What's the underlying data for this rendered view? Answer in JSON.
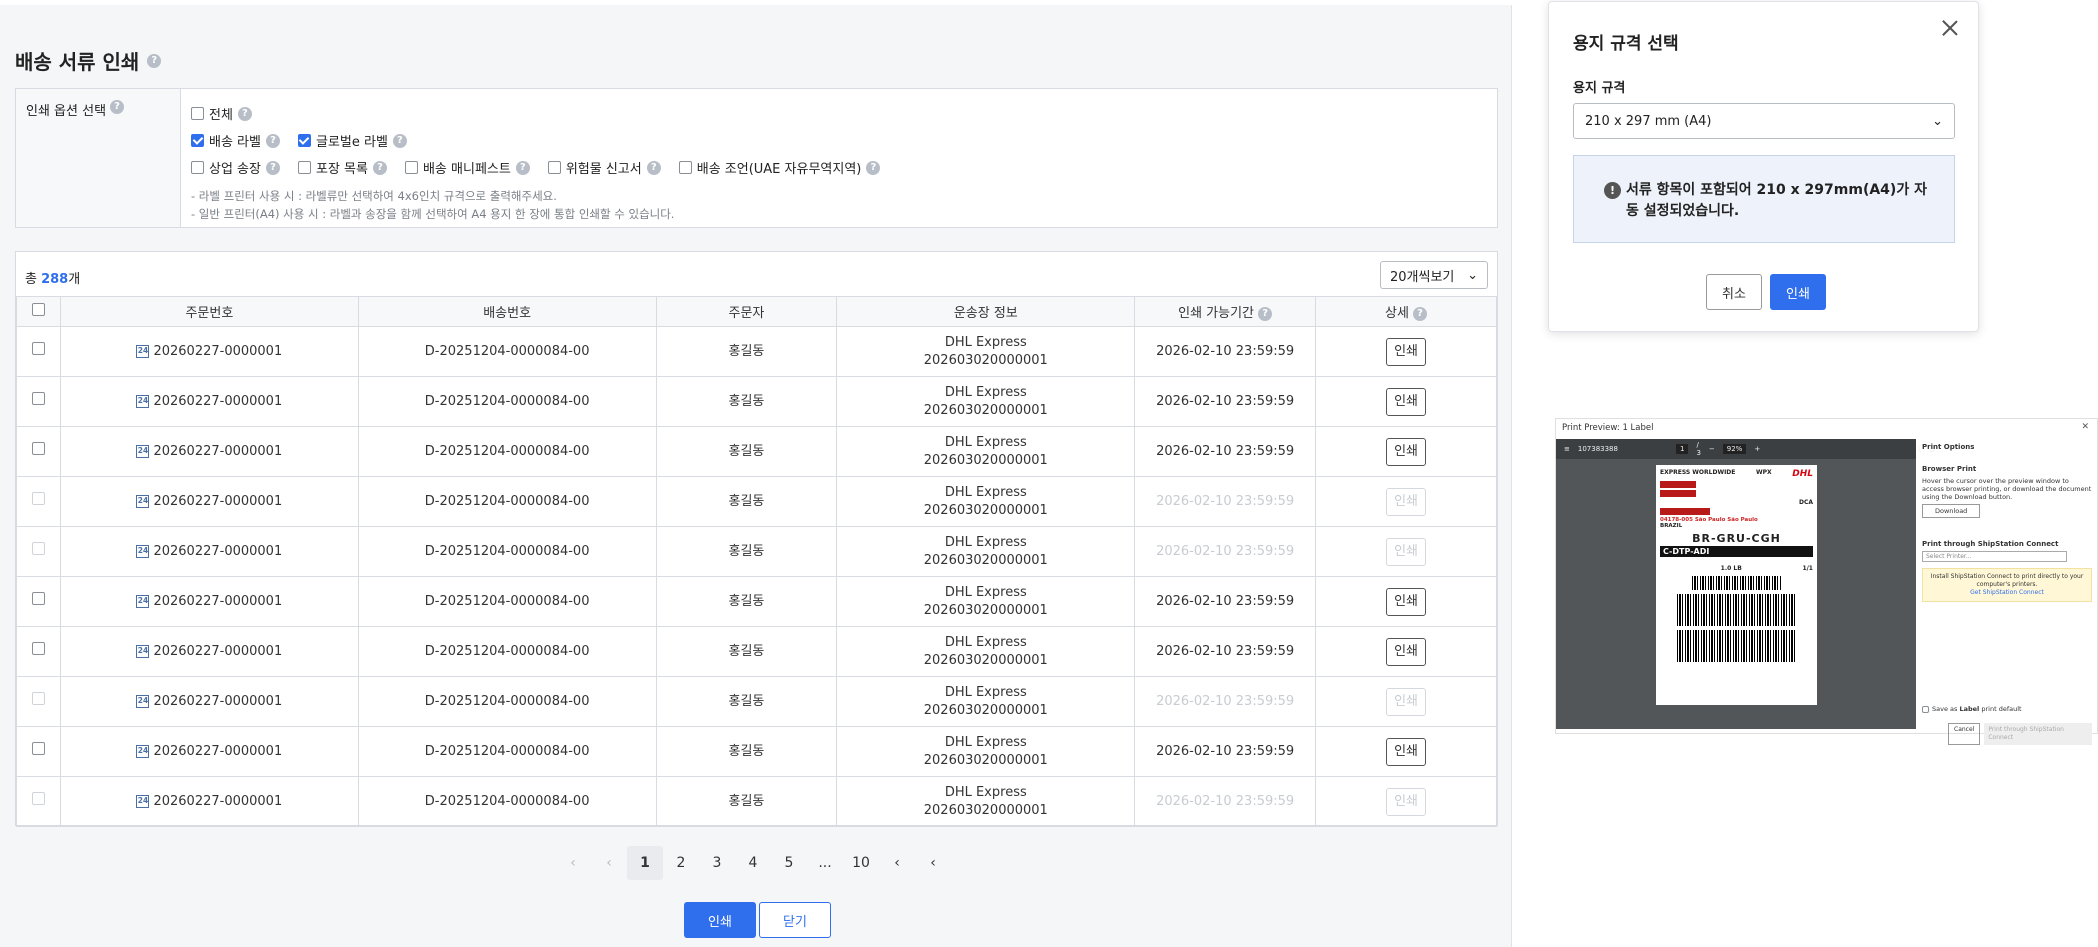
{
  "page": {
    "title": "배송 서류 인쇄",
    "help_icon": "?"
  },
  "options": {
    "label": "인쇄 옵션 선택",
    "row1": [
      {
        "label": "전체",
        "checked": false
      }
    ],
    "row2": [
      {
        "label": "배송 라벨",
        "checked": true
      },
      {
        "label": "글로벌e 라벨",
        "checked": true
      }
    ],
    "row3": [
      {
        "label": "상업 송장",
        "checked": false
      },
      {
        "label": "포장 목록",
        "checked": false
      },
      {
        "label": "배송 매니페스트",
        "checked": false
      },
      {
        "label": "위험물 신고서",
        "checked": false
      },
      {
        "label": "배송 조언(UAE 자유무역지역)",
        "checked": false
      }
    ],
    "note1": "- 라벨 프린터 사용 시 : 라벨류만 선택하여 4x6인치 규격으로 출력해주세요.",
    "note2": "- 일반 프린터(A4) 사용 시 : 라벨과 송장을 함께 선택하여 A4 용지 한 장에 통합 인쇄할 수 있습니다."
  },
  "table": {
    "total_prefix": "총 ",
    "total_count": "288",
    "total_suffix": "개",
    "per_page": "20개씩보기",
    "headers": {
      "order_no": "주문번호",
      "ship_no": "배송번호",
      "orderer": "주문자",
      "waybill": "운송장 정보",
      "print_period": "인쇄 가능기간",
      "detail": "상세"
    },
    "rows": [
      {
        "order_no": "20260227-0000001",
        "ship_no": "D-20251204-0000084-00",
        "orderer": "홍길동",
        "carrier": "DHL Express",
        "waybill_no": "202603020000001",
        "period": "2026-02-10 23:59:59",
        "action": "인쇄",
        "enabled": true
      },
      {
        "order_no": "20260227-0000001",
        "ship_no": "D-20251204-0000084-00",
        "orderer": "홍길동",
        "carrier": "DHL Express",
        "waybill_no": "202603020000001",
        "period": "2026-02-10 23:59:59",
        "action": "인쇄",
        "enabled": true
      },
      {
        "order_no": "20260227-0000001",
        "ship_no": "D-20251204-0000084-00",
        "orderer": "홍길동",
        "carrier": "DHL Express",
        "waybill_no": "202603020000001",
        "period": "2026-02-10 23:59:59",
        "action": "인쇄",
        "enabled": true
      },
      {
        "order_no": "20260227-0000001",
        "ship_no": "D-20251204-0000084-00",
        "orderer": "홍길동",
        "carrier": "DHL Express",
        "waybill_no": "202603020000001",
        "period": "2026-02-10 23:59:59",
        "action": "인쇄",
        "enabled": false
      },
      {
        "order_no": "20260227-0000001",
        "ship_no": "D-20251204-0000084-00",
        "orderer": "홍길동",
        "carrier": "DHL Express",
        "waybill_no": "202603020000001",
        "period": "2026-02-10 23:59:59",
        "action": "인쇄",
        "enabled": false
      },
      {
        "order_no": "20260227-0000001",
        "ship_no": "D-20251204-0000084-00",
        "orderer": "홍길동",
        "carrier": "DHL Express",
        "waybill_no": "202603020000001",
        "period": "2026-02-10 23:59:59",
        "action": "인쇄",
        "enabled": true
      },
      {
        "order_no": "20260227-0000001",
        "ship_no": "D-20251204-0000084-00",
        "orderer": "홍길동",
        "carrier": "DHL Express",
        "waybill_no": "202603020000001",
        "period": "2026-02-10 23:59:59",
        "action": "인쇄",
        "enabled": true
      },
      {
        "order_no": "20260227-0000001",
        "ship_no": "D-20251204-0000084-00",
        "orderer": "홍길동",
        "carrier": "DHL Express",
        "waybill_no": "202603020000001",
        "period": "2026-02-10 23:59:59",
        "action": "인쇄",
        "enabled": false
      },
      {
        "order_no": "20260227-0000001",
        "ship_no": "D-20251204-0000084-00",
        "orderer": "홍길동",
        "carrier": "DHL Express",
        "waybill_no": "202603020000001",
        "period": "2026-02-10 23:59:59",
        "action": "인쇄",
        "enabled": true
      },
      {
        "order_no": "20260227-0000001",
        "ship_no": "D-20251204-0000084-00",
        "orderer": "홍길동",
        "carrier": "DHL Express",
        "waybill_no": "202603020000001",
        "period": "2026-02-10 23:59:59",
        "action": "인쇄",
        "enabled": false
      }
    ]
  },
  "pagination": {
    "first": "‹",
    "prev": "‹",
    "pages": [
      "1",
      "2",
      "3",
      "4",
      "5",
      "...",
      "10"
    ],
    "current": "1",
    "next": "‹",
    "last": "‹"
  },
  "footer": {
    "print": "인쇄",
    "close": "닫기"
  },
  "modal": {
    "title": "용지 규격 선택",
    "field_label": "용지 규격",
    "selected": "210 x 297 mm (A4)",
    "info_icon": "!",
    "info_text": "서류 항목이 포함되어 210 x 297mm(A4)가 자동 설정되었습니다.",
    "cancel": "취소",
    "ok": "인쇄"
  },
  "print_preview": {
    "title": "Print Preview: 1 Label",
    "doc_id": "107383388",
    "page": "1",
    "page_total": "/ 3",
    "zoom": "92%",
    "label": {
      "service": "EXPRESS WORLDWIDE",
      "product": "WPX",
      "brand": "DHL",
      "dest_code": "DCA",
      "address": "04178-005 São Paulo São Paulo",
      "country": "BRAZIL",
      "route": "BR-GRU-CGH",
      "facility": "C-DTP-ADI",
      "weight": "1.0 LB",
      "pieces": "1/1"
    },
    "options_title": "Print Options",
    "browser_print_title": "Browser Print",
    "browser_print_desc": "Hover the cursor over the preview window to access browser printing, or download the document using the Download button.",
    "download": "Download",
    "ss_title": "Print through ShipStation Connect",
    "select_printer": "Select Printer...",
    "warn": "Install ShipStation Connect to print directly to your computer's printers.",
    "warn_link": "Get ShipStation Connect",
    "save_default_prefix": "Save as ",
    "save_default_bold": "Label",
    "save_default_suffix": " print default",
    "cancel": "Cancel",
    "print_ss": "Print through ShipStation Connect"
  }
}
